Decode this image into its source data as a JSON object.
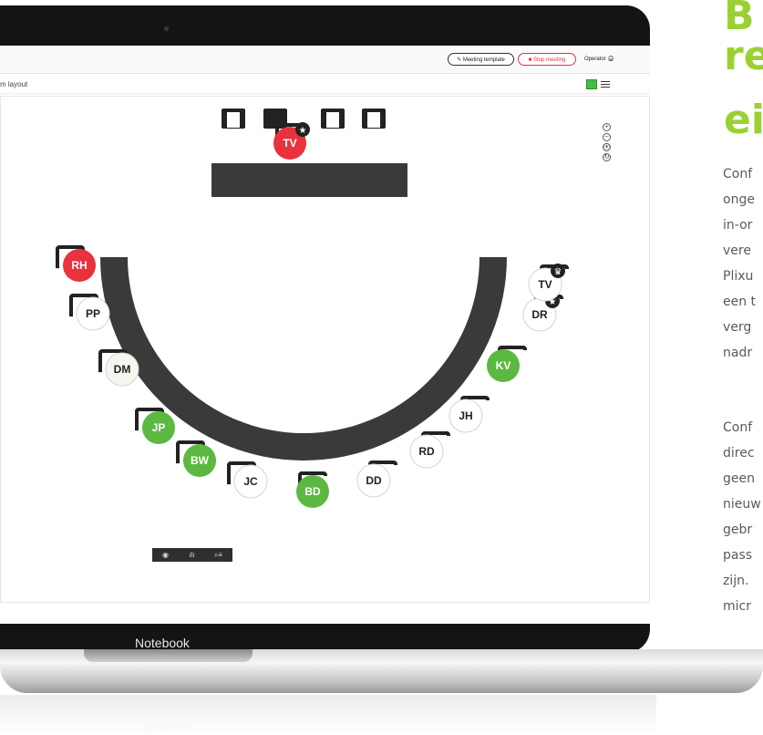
{
  "app": {
    "meeting_template_label": "Meeting template",
    "stop_meeting_label": "Stop meeting",
    "operator_label": "Operator",
    "layout_label": "m layout",
    "zoom_in": "+",
    "zoom_out": "−",
    "fit": "⦿",
    "reset": "↻",
    "bottom_icons": [
      "◉",
      "ılı",
      "⌕≡"
    ]
  },
  "seats": {
    "chair_top": {
      "initials": "TV",
      "status": "red",
      "badge": "star-icon"
    },
    "ring": [
      {
        "initials": "RH",
        "status": "red"
      },
      {
        "initials": "PP",
        "status": "white"
      },
      {
        "initials": "DM",
        "status": "offwhite"
      },
      {
        "initials": "JP",
        "status": "green"
      },
      {
        "initials": "BW",
        "status": "green"
      },
      {
        "initials": "JC",
        "status": "white"
      },
      {
        "initials": "BD",
        "status": "green"
      },
      {
        "initials": "DD",
        "status": "white"
      },
      {
        "initials": "RD",
        "status": "white"
      },
      {
        "initials": "JH",
        "status": "white"
      },
      {
        "initials": "KV",
        "status": "green"
      },
      {
        "initials": "DR",
        "status": "white",
        "badge": "star-icon"
      },
      {
        "initials": "TV",
        "status": "white",
        "badge": "crown-icon"
      }
    ]
  },
  "device_label": "Notebook",
  "colors": {
    "green": "#5cb840",
    "red": "#e8323e",
    "accent": "#9ad131"
  },
  "side": {
    "heading_lines": [
      "B",
      "re",
      "ei"
    ],
    "para1": [
      "Conf",
      "onge",
      "in-or",
      "vere",
      "Plixu",
      "een t",
      "verg",
      "nadr"
    ],
    "para2": [
      "Conf",
      "direc",
      "geen",
      "nieuw",
      "gebr",
      "pass",
      "zijn.",
      "micr"
    ]
  }
}
